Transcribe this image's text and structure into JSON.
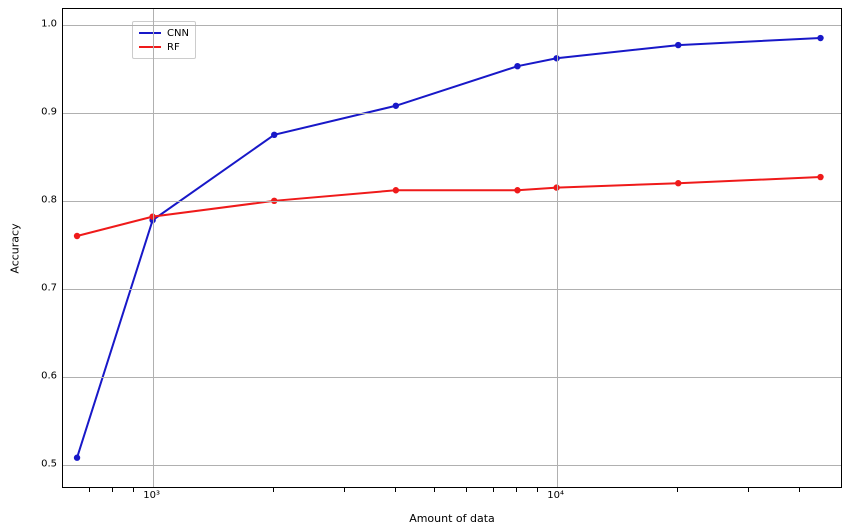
{
  "chart_data": {
    "type": "line",
    "xlabel": "Amount of data",
    "ylabel": "Accuracy",
    "title": "",
    "xscale": "log",
    "xlim": [
      600,
      50000
    ],
    "ylim": [
      0.477,
      1.018
    ],
    "xticks_major": [
      1000,
      10000
    ],
    "xtick_labels": [
      "10³",
      "10⁴"
    ],
    "xticks_minor": [
      700,
      800,
      900,
      2000,
      3000,
      4000,
      5000,
      6000,
      7000,
      8000,
      9000,
      20000,
      30000,
      40000,
      50000
    ],
    "yticks": [
      0.5,
      0.6,
      0.7,
      0.8,
      0.9,
      1.0
    ],
    "x": [
      650,
      1000,
      2000,
      4000,
      8000,
      10000,
      20000,
      45000
    ],
    "series": [
      {
        "name": "CNN",
        "color": "#1818c8",
        "values": [
          0.508,
          0.778,
          0.875,
          0.908,
          0.953,
          0.962,
          0.977,
          0.985
        ]
      },
      {
        "name": "RF",
        "color": "#ef1a1a",
        "values": [
          0.76,
          0.782,
          0.8,
          0.812,
          0.812,
          0.815,
          0.82,
          0.827
        ]
      }
    ],
    "legend_position": "upper-left",
    "grid": true
  }
}
